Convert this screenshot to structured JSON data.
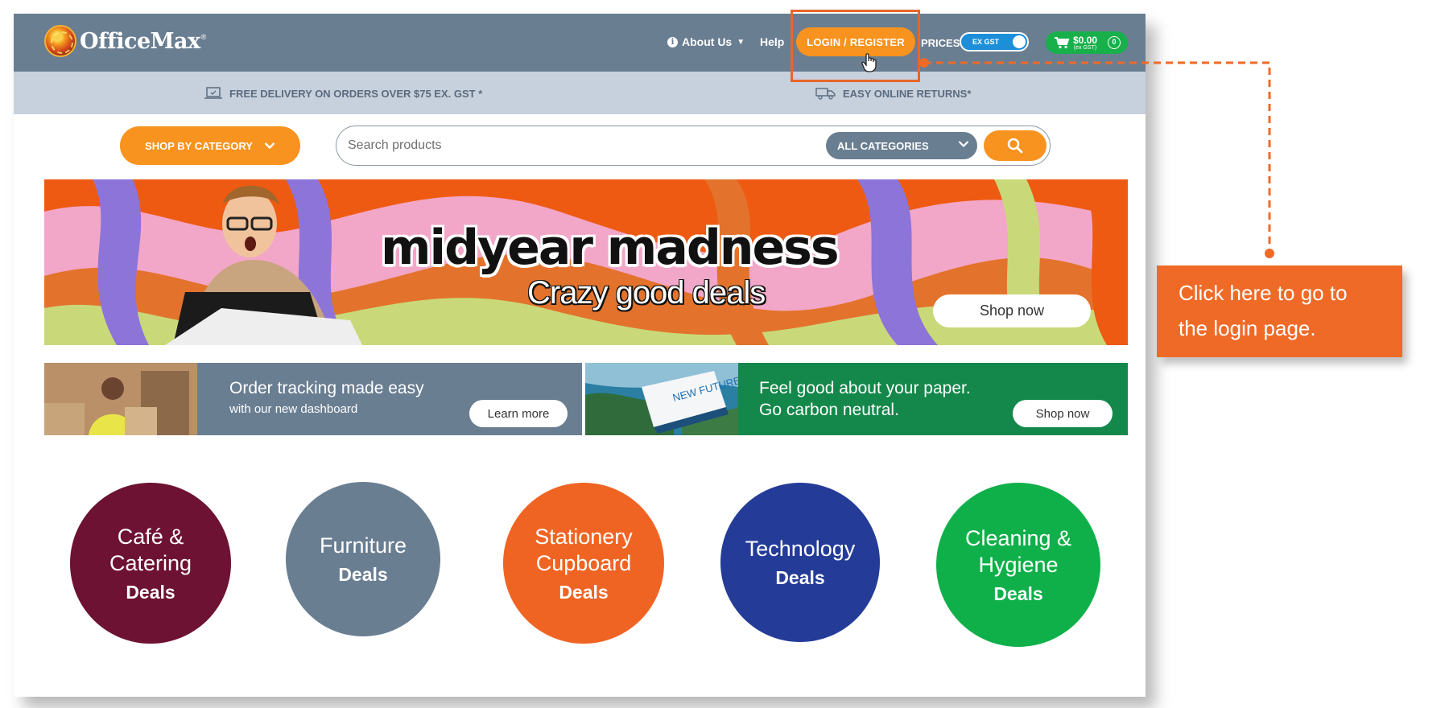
{
  "brand": {
    "name": "OfficeMax",
    "trademark": "®"
  },
  "header": {
    "about_label": "About Us",
    "help_label": "Help",
    "login_label": "LOGIN / REGISTER",
    "prices_label": "PRICES",
    "gst_toggle_label": "EX GST",
    "cart_amount": "$0.00",
    "cart_sub": "(ex GST)",
    "cart_count": "0"
  },
  "infobar": {
    "delivery": "FREE DELIVERY ON ORDERS OVER $75 EX. GST *",
    "returns": "EASY ONLINE RETURNS*"
  },
  "search": {
    "shop_by_category": "SHOP BY CATEGORY",
    "placeholder": "Search products",
    "category_selected": "ALL CATEGORIES"
  },
  "hero": {
    "title": "midyear madness",
    "subtitle": "Crazy good deals",
    "button": "Shop now"
  },
  "promos": [
    {
      "title": "Order tracking made easy",
      "subtitle": "with our new dashboard",
      "button": "Learn more"
    },
    {
      "title_line1": "Feel good about your paper.",
      "title_line2": "Go carbon neutral.",
      "button": "Shop now",
      "product_text": "NEW FUTURE"
    }
  ],
  "categories": [
    {
      "name": "Café & Catering",
      "deals": "Deals",
      "color": "#6d1232"
    },
    {
      "name": "Furniture",
      "deals": "Deals",
      "color": "#6a7e92"
    },
    {
      "name": "Stationery Cupboard",
      "deals": "Deals",
      "color": "#f06423"
    },
    {
      "name": "Technology",
      "deals": "Deals",
      "color": "#243c98"
    },
    {
      "name": "Cleaning & Hygiene",
      "deals": "Deals",
      "color": "#0fb04a"
    }
  ],
  "callout": {
    "line1": "Click here to go to",
    "line2": "the login page."
  },
  "colors": {
    "header_bg": "#6a7e92",
    "accent_orange": "#f7931e",
    "callout_orange": "#f06a27",
    "cart_green": "#17b04b",
    "toggle_blue": "#1d8fd8"
  },
  "icons": [
    "info-icon",
    "caret-down-icon",
    "cursor-hand-icon",
    "cart-icon",
    "laptop-icon",
    "truck-icon",
    "chevron-down-icon",
    "search-icon"
  ]
}
